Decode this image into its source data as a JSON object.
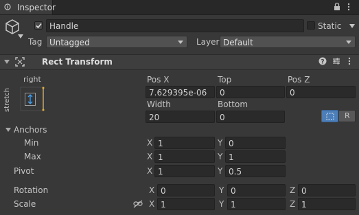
{
  "tab": {
    "title": "Inspector"
  },
  "object": {
    "name": "Handle",
    "static_label": "Static",
    "tag_label": "Tag",
    "tag_value": "Untagged",
    "layer_label": "Layer",
    "layer_value": "Default"
  },
  "component": {
    "title": "Rect Transform"
  },
  "anchor_preset": {
    "top_label": "right",
    "side_label": "stretch"
  },
  "pos_headers": {
    "col1": "Pos X",
    "col2": "Top",
    "col3": "Pos Z"
  },
  "pos_values": {
    "col1": "7.629395e-06",
    "col2": "0",
    "col3": "0"
  },
  "size_headers": {
    "col1": "Width",
    "col2": "Bottom"
  },
  "size_values": {
    "col1": "20",
    "col2": "0"
  },
  "raw_button": {
    "label": "R"
  },
  "anchors": {
    "label": "Anchors",
    "min_label": "Min",
    "min_x": "1",
    "min_y": "0",
    "max_label": "Max",
    "max_x": "1",
    "max_y": "1"
  },
  "pivot": {
    "label": "Pivot",
    "x": "1",
    "y": "0.5"
  },
  "rotation": {
    "label": "Rotation",
    "x": "0",
    "y": "0",
    "z": "0"
  },
  "scale": {
    "label": "Scale",
    "x": "1",
    "y": "1",
    "z": "1"
  },
  "axis_letters": {
    "x": "X",
    "y": "Y",
    "z": "Z"
  },
  "colors": {
    "background": "#383838",
    "field": "#2a2a2a",
    "accent_blue": "#4c7eb8",
    "anchor_orange": "#e8b030"
  },
  "icons": [
    "lock-icon",
    "more-menu-icon",
    "gameobject-cube-icon",
    "checkbox-checked-icon",
    "help-icon",
    "sliders-icon",
    "kebab-menu-icon",
    "rect-transform-icon",
    "blueprint-mode-icon",
    "constrain-proportions-icon"
  ]
}
